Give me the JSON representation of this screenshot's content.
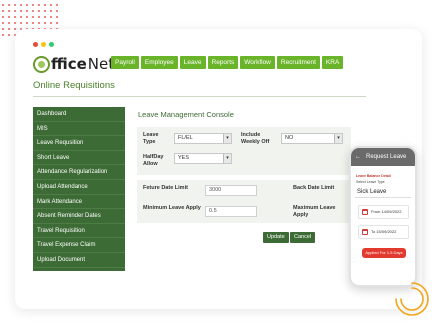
{
  "topnav": [
    "Payroll",
    "Employee",
    "Leave",
    "Reports",
    "Workflow",
    "Recruitment",
    "KRA"
  ],
  "logo": {
    "first": "ffice",
    "second": "Net",
    "mark": "®"
  },
  "page_title": "Online Requisitions",
  "sidebar": [
    "Dashboard",
    "MIS",
    "Leave Requsition",
    "Short Leave",
    "Attendance Regularization",
    "Upload Attendance",
    "Mark Attendance",
    "Absent Reminder Dates",
    "Travel Requisition",
    "Travel Expense Claim",
    "Upload Document"
  ],
  "console_title": "Leave Management Console",
  "form": {
    "leave_type_label": "Leave Type",
    "leave_type_value": "FL/EL",
    "include_weekly_off_label": "Include Weekly Off",
    "include_weekly_off_value": "NO",
    "halfday_label": "HalfDay Allow",
    "halfday_value": "YES",
    "future_date_label": "Feture Date Limit",
    "future_date_value": "3000",
    "back_date_label": "Back Date Limit",
    "min_leave_label": "Minimum Leave Apply",
    "min_leave_value": "0.5",
    "max_leave_label": "Maximum Leave Apply",
    "update_label": "Update",
    "cancel_label": "Cancel",
    "arrow_glyph": "▾"
  },
  "phone": {
    "back_glyph": "←",
    "title": "Request Leave",
    "balance_label": "Leave Balance Detail",
    "select_label": "Select Leave Type",
    "selected_type": "Sick Leave",
    "from_date": "From  14/09/2022",
    "to_date": "To  15/09/2022",
    "apply_label": "Applied For 1.5 Days"
  },
  "colors": {
    "brand_green": "#6ab42a",
    "sidebar_green": "#3d6b35",
    "accent_red": "#e23a2e",
    "swirl_orange": "#f2a51c"
  }
}
